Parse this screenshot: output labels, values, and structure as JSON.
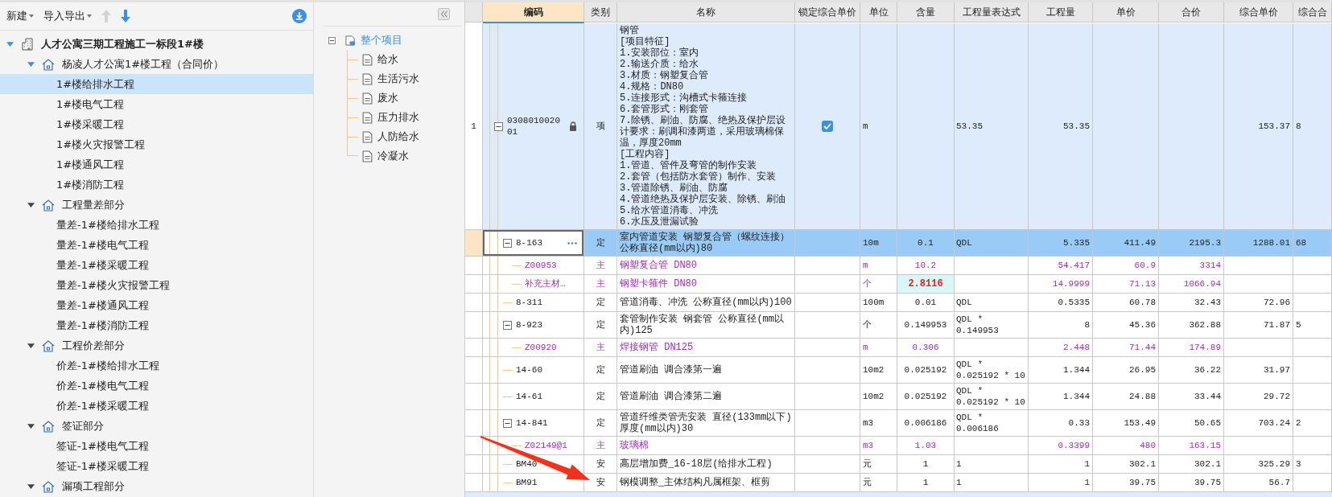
{
  "toolbar": {
    "new_label": "新建",
    "import_export_label": "导入导出",
    "move_up_disabled": true,
    "move_down_disabled": false
  },
  "project_tree": [
    {
      "label": "人才公寓三期工程施工一标段1#楼",
      "kind": "building",
      "expanded": true,
      "selected": false,
      "children": [
        {
          "label": "杨凌人才公寓1#楼工程（合同价）",
          "kind": "group",
          "expanded": true,
          "selected": false,
          "children": [
            {
              "label": "1#楼给排水工程",
              "kind": "leaf",
              "selected": true
            },
            {
              "label": "1#楼电气工程",
              "kind": "leaf",
              "selected": false
            },
            {
              "label": "1#楼采暖工程",
              "kind": "leaf",
              "selected": false
            },
            {
              "label": "1#楼火灾报警工程",
              "kind": "leaf",
              "selected": false
            },
            {
              "label": "1#楼通风工程",
              "kind": "leaf",
              "selected": false
            },
            {
              "label": "1#楼消防工程",
              "kind": "leaf",
              "selected": false
            }
          ]
        },
        {
          "label": "工程量差部分",
          "kind": "group",
          "expanded": true,
          "selected": false,
          "children": [
            {
              "label": "量差-1#楼给排水工程",
              "kind": "leaf",
              "selected": false
            },
            {
              "label": "量差-1#楼电气工程",
              "kind": "leaf",
              "selected": false
            },
            {
              "label": "量差-1#楼采暖工程",
              "kind": "leaf",
              "selected": false
            },
            {
              "label": "量差-1#楼火灾报警工程",
              "kind": "leaf",
              "selected": false
            },
            {
              "label": "量差-1#楼通风工程",
              "kind": "leaf",
              "selected": false
            },
            {
              "label": "量差-1#楼消防工程",
              "kind": "leaf",
              "selected": false
            }
          ]
        },
        {
          "label": "工程价差部分",
          "kind": "group",
          "expanded": true,
          "selected": false,
          "children": [
            {
              "label": "价差-1#楼给排水工程",
              "kind": "leaf",
              "selected": false
            },
            {
              "label": "价差-1#楼电气工程",
              "kind": "leaf",
              "selected": false
            },
            {
              "label": "价差-1#楼采暖工程",
              "kind": "leaf",
              "selected": false
            }
          ]
        },
        {
          "label": "签证部分",
          "kind": "group",
          "expanded": true,
          "selected": false,
          "children": [
            {
              "label": "签证-1#楼电气工程",
              "kind": "leaf",
              "selected": false
            },
            {
              "label": "签证-1#楼采暖工程",
              "kind": "leaf",
              "selected": false
            }
          ]
        },
        {
          "label": "漏项工程部分",
          "kind": "group",
          "expanded": true,
          "selected": false
        }
      ]
    }
  ],
  "section_tree": [
    {
      "label": "整个项目",
      "kind": "root",
      "expanded": true,
      "selected": true,
      "children": [
        {
          "label": "给水",
          "kind": "leaf",
          "selected": false
        },
        {
          "label": "生活污水",
          "kind": "leaf",
          "selected": false
        },
        {
          "label": "废水",
          "kind": "leaf",
          "selected": false
        },
        {
          "label": "压力排水",
          "kind": "leaf",
          "selected": false
        },
        {
          "label": "人防给水",
          "kind": "leaf",
          "selected": false
        },
        {
          "label": "冷凝水",
          "kind": "leaf",
          "selected": false
        }
      ]
    }
  ],
  "table": {
    "columns": [
      {
        "label": "编码",
        "selected": true
      },
      {
        "label": "类别",
        "selected": false
      },
      {
        "label": "名称",
        "selected": false
      },
      {
        "label": "锁定综合单价",
        "selected": false
      },
      {
        "label": "单位",
        "selected": false
      },
      {
        "label": "含量",
        "selected": false
      },
      {
        "label": "工程量表达式",
        "selected": false
      },
      {
        "label": "工程量",
        "selected": false
      },
      {
        "label": "单价",
        "selected": false
      },
      {
        "label": "合价",
        "selected": false
      },
      {
        "label": "综合单价",
        "selected": false
      },
      {
        "label": "综合合",
        "selected": false
      }
    ],
    "rows": [
      {
        "row_number": "1",
        "code": "030801002001",
        "locked": true,
        "type": "项",
        "kind": "bill",
        "name": "钢管\n[项目特征]\n1.安装部位：室内\n2.输送介质：给水\n3.材质：钢塑复合管\n4.规格：DN80\n5.连接形式：沟槽式卡箍连接\n6.套管形式：刚套管\n7.除锈、刷油、防腐、绝热及保护层设计要求：刷调和漆两道，采用玻璃棉保温，厚度20mm\n[工程内容]\n1.管道、管件及弯管的制作安装\n2.套管（包括防水套管）制作、安装\n3.管道除锈、刷油、防腐\n4.管道绝热及保护层安装、除锈、刷油\n5.给水管道消毒、冲洗\n6.水压及泄漏试验",
        "price_locked": true,
        "unit": "m",
        "expr": "53.35",
        "amount": "53.35",
        "comp_price": "153.37",
        "comp_total": "8",
        "selected": false,
        "expanded": true,
        "children": [
          {
            "code": "8-163",
            "type": "定",
            "name": "室内管道安装 钢塑复合管（螺纹连接）公称直径(mm以内)80",
            "unit": "10m",
            "qty": "0.1",
            "expr": "QDL",
            "amount": "5.335",
            "price": "411.49",
            "total": "2195.3",
            "comp_price": "1288.01",
            "comp_total": "68",
            "selected": true,
            "expanded": true,
            "children": [
              {
                "code": "Z00953",
                "type": "主",
                "kind": "material",
                "name": "钢塑复合管 DN80",
                "unit": "m",
                "qty": "10.2",
                "amount": "54.417",
                "price": "60.9",
                "total": "3314",
                "selected": false
              },
              {
                "code": "补充主材…",
                "type": "主",
                "kind": "material",
                "name": "钢塑卡箍件 DN80",
                "unit": "个",
                "qty": "2.8116",
                "qty_highlight": true,
                "amount": "14.9999",
                "price": "71.13",
                "total": "1066.94",
                "selected": false
              }
            ]
          },
          {
            "code": "8-311",
            "type": "定",
            "name": "管道消毒、冲洗 公称直径(mm以内)100",
            "unit": "100m",
            "qty": "0.01",
            "expr": "QDL",
            "amount": "0.5335",
            "price": "60.78",
            "total": "32.43",
            "comp_price": "72.96",
            "selected": false
          },
          {
            "code": "8-923",
            "type": "定",
            "name": "套管制作安装 钢套管 公称直径(mm以内)125",
            "unit": "个",
            "qty": "0.149953",
            "expr": "QDL * 0.149953",
            "amount": "8",
            "price": "45.36",
            "total": "362.88",
            "comp_price": "71.87",
            "comp_total": "5",
            "selected": false,
            "expanded": true,
            "children": [
              {
                "code": "Z00920",
                "type": "主",
                "kind": "material",
                "name": "焊接钢管 DN125",
                "unit": "m",
                "qty": "0.306",
                "amount": "2.448",
                "price": "71.44",
                "total": "174.89",
                "selected": false
              }
            ]
          },
          {
            "code": "14-60",
            "type": "定",
            "name": "管道刷油 调合漆第一遍",
            "unit": "10m2",
            "qty": "0.025192",
            "expr": "QDL * 0.025192 * 10",
            "amount": "1.344",
            "price": "26.95",
            "total": "36.22",
            "comp_price": "31.97",
            "selected": false
          },
          {
            "code": "14-61",
            "type": "定",
            "name": "管道刷油 调合漆第二遍",
            "unit": "10m2",
            "qty": "0.025192",
            "expr": "QDL * 0.025192 * 10",
            "amount": "1.344",
            "price": "24.88",
            "total": "33.44",
            "comp_price": "29.72",
            "selected": false
          },
          {
            "code": "14-841",
            "type": "定",
            "name": "管道纤维类管壳安装 直径(133mm以下)厚度(mm以内)30",
            "unit": "m3",
            "qty": "0.006186",
            "expr": "QDL * 0.006186",
            "amount": "0.33",
            "price": "153.49",
            "total": "50.65",
            "comp_price": "703.24",
            "comp_total": "2",
            "selected": false,
            "expanded": true,
            "children": [
              {
                "code": "Z02149@1",
                "type": "主",
                "kind": "material",
                "name": "玻璃棉",
                "unit": "m3",
                "qty": "1.03",
                "amount": "0.3399",
                "price": "480",
                "total": "163.15",
                "selected": false
              }
            ]
          },
          {
            "code": "BM40",
            "type": "安",
            "name": "高层增加费_16-18层(给排水工程)",
            "unit": "元",
            "qty": "1",
            "expr": "1",
            "amount": "1",
            "price": "302.1",
            "total": "302.1",
            "comp_price": "325.29",
            "comp_total": "3",
            "selected": false
          },
          {
            "code": "BM91",
            "type": "安",
            "name": "钢模调整_主体结构凡属框架、框剪",
            "unit": "元",
            "qty": "1",
            "expr": "1",
            "amount": "1",
            "price": "39.75",
            "total": "39.75",
            "comp_price": "56.7",
            "selected": false
          }
        ]
      }
    ]
  }
}
